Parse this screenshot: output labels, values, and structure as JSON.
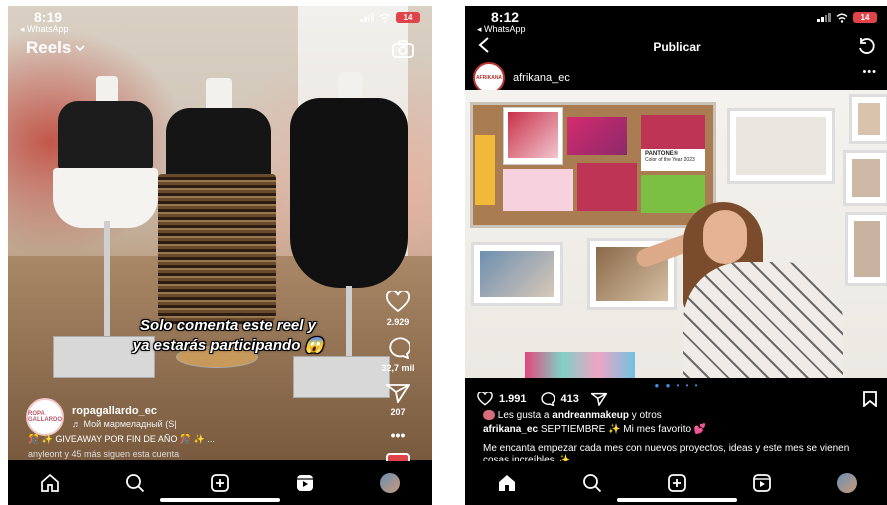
{
  "left": {
    "status": {
      "time": "8:19",
      "back_app": "◂ WhatsApp",
      "battery": "14"
    },
    "header": {
      "title": "Reels"
    },
    "caption": {
      "line1": "Solo comenta este reel y",
      "line2": "ya estarás participando 😱"
    },
    "actions": {
      "likes": "2.929",
      "comments": "32,7 mil",
      "shares": "207"
    },
    "user": {
      "name": "ropagallardo_ec",
      "avatar_text": "ROPA GALLARDO",
      "music": "♬  Мой мармеладный (S|"
    },
    "giveaway": "🎊 ✨ GIVEAWAY POR FIN DE AÑO 🎊 ✨ ...",
    "followers": "anyleont y 45 más siguen esta cuenta"
  },
  "right": {
    "status": {
      "time": "8:12",
      "back_app": "◂ WhatsApp",
      "battery": "14"
    },
    "topbar": {
      "title": "Publicar"
    },
    "post": {
      "username": "afrikana_ec",
      "avatar_text": "AFRIKANA",
      "more": "•••",
      "likes": "1.991",
      "comments": "413",
      "liked_by_prefix": "Les gusta a",
      "liked_by_user": "andreanmakeup",
      "liked_by_suffix": "y otros",
      "caption_user": "afrikana_ec",
      "caption_text": "SEPTIEMBRE ✨  Mi mes favorito 💕",
      "body": "Me encanta empezar cada mes con nuevos proyectos, ideas y este mes se vienen cosas increíbles ✨",
      "pantone_card": "PANTONE®",
      "color_year": "Color of the Year 2023"
    }
  },
  "colors": {
    "accent": "#4a90e2",
    "battery": "#e0434a"
  }
}
